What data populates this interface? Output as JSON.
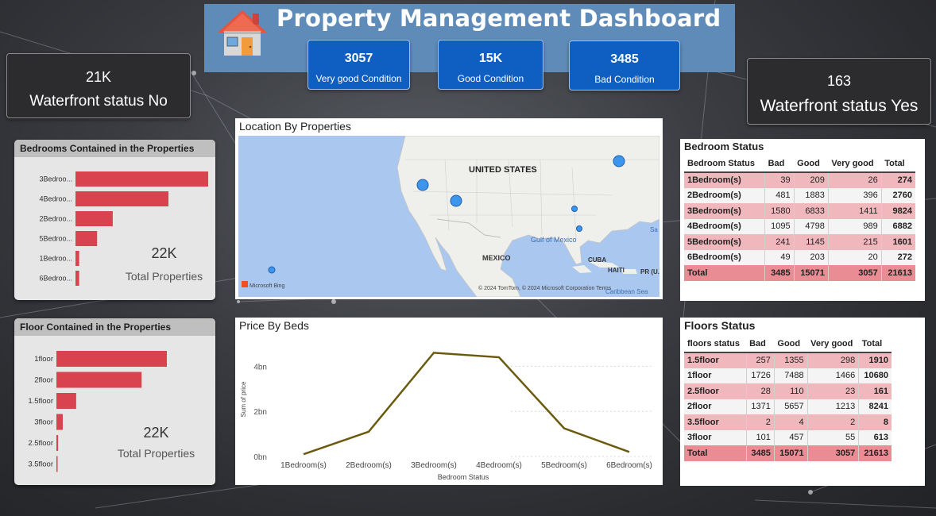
{
  "title": "Property Management Dashboard",
  "kpis": [
    {
      "value": "3057",
      "label": "Very good Condition"
    },
    {
      "value": "15K",
      "label": "Good Condition"
    },
    {
      "value": "3485",
      "label": "Bad Condition"
    }
  ],
  "waterfront_no": {
    "value": "21K",
    "label": "Waterfront status No"
  },
  "waterfront_yes": {
    "value": "163",
    "label": "Waterfront status Yes"
  },
  "bedrooms_panel": {
    "title": "Bedrooms Contained in the Properties",
    "kpi_value": "22K",
    "kpi_label": "Total Properties",
    "bar_color": "#d9434f",
    "chart_data": {
      "type": "bar",
      "categories": [
        "3Bedroo...",
        "4Bedroo...",
        "2Bedroo...",
        "5Bedroo...",
        "1Bedroo...",
        "6Bedroo..."
      ],
      "values": [
        9824,
        6882,
        2760,
        1601,
        274,
        272
      ]
    }
  },
  "floors_panel": {
    "title": "Floor Contained in the Properties",
    "kpi_value": "22K",
    "kpi_label": "Total Properties",
    "bar_color": "#d9434f",
    "chart_data": {
      "type": "bar",
      "categories": [
        "1floor",
        "2floor",
        "1.5floor",
        "3floor",
        "2.5floor",
        "3.5floor"
      ],
      "values": [
        10680,
        8241,
        1910,
        613,
        161,
        8
      ]
    }
  },
  "map": {
    "title": "Location By Properties",
    "country_label": "UNITED STATES",
    "labels": [
      "MEXICO",
      "Gulf of Mexico",
      "CUBA",
      "HAITI",
      "PR (U.S.)",
      "Caribbean Sea",
      "Sa"
    ],
    "attribution": "© 2024 TomTom, © 2024 Microsoft Corporation  Terms",
    "bing": "Microsoft Bing"
  },
  "price_chart": {
    "title": "Price By Beds",
    "ylabel": "Sum of price",
    "xlabel": "Bedroom Status",
    "y_ticks": [
      "0bn",
      "2bn",
      "4bn"
    ],
    "line_color": "#6b5a0d",
    "chart_data": {
      "type": "line",
      "categories": [
        "1Bedroom(s)",
        "2Bedroom(s)",
        "3Bedroom(s)",
        "4Bedroom(s)",
        "5Bedroom(s)",
        "6Bedroom(s)"
      ],
      "values": [
        0.1,
        1.1,
        4.6,
        4.4,
        1.25,
        0.2
      ],
      "unit": "bn",
      "ylim": [
        0,
        5.0
      ]
    }
  },
  "bedroom_status": {
    "title": "Bedroom Status",
    "headers": [
      "Bedroom Status",
      "Bad",
      "Good",
      "Very good",
      "Total"
    ],
    "rows": [
      [
        "1Bedroom(s)",
        "39",
        "209",
        "26",
        "274"
      ],
      [
        "2Bedroom(s)",
        "481",
        "1883",
        "396",
        "2760"
      ],
      [
        "3Bedroom(s)",
        "1580",
        "6833",
        "1411",
        "9824"
      ],
      [
        "4Bedroom(s)",
        "1095",
        "4798",
        "989",
        "6882"
      ],
      [
        "5Bedroom(s)",
        "241",
        "1145",
        "215",
        "1601"
      ],
      [
        "6Bedroom(s)",
        "49",
        "203",
        "20",
        "272"
      ]
    ],
    "total": [
      "Total",
      "3485",
      "15071",
      "3057",
      "21613"
    ]
  },
  "floors_status": {
    "title": "Floors Status",
    "headers": [
      "floors status",
      "Bad",
      "Good",
      "Very good",
      "Total"
    ],
    "rows": [
      [
        "1.5floor",
        "257",
        "1355",
        "298",
        "1910"
      ],
      [
        "1floor",
        "1726",
        "7488",
        "1466",
        "10680"
      ],
      [
        "2.5floor",
        "28",
        "110",
        "23",
        "161"
      ],
      [
        "2floor",
        "1371",
        "5657",
        "1213",
        "8241"
      ],
      [
        "3.5floor",
        "2",
        "4",
        "2",
        "8"
      ],
      [
        "3floor",
        "101",
        "457",
        "55",
        "613"
      ]
    ],
    "total": [
      "Total",
      "3485",
      "15071",
      "3057",
      "21613"
    ]
  }
}
